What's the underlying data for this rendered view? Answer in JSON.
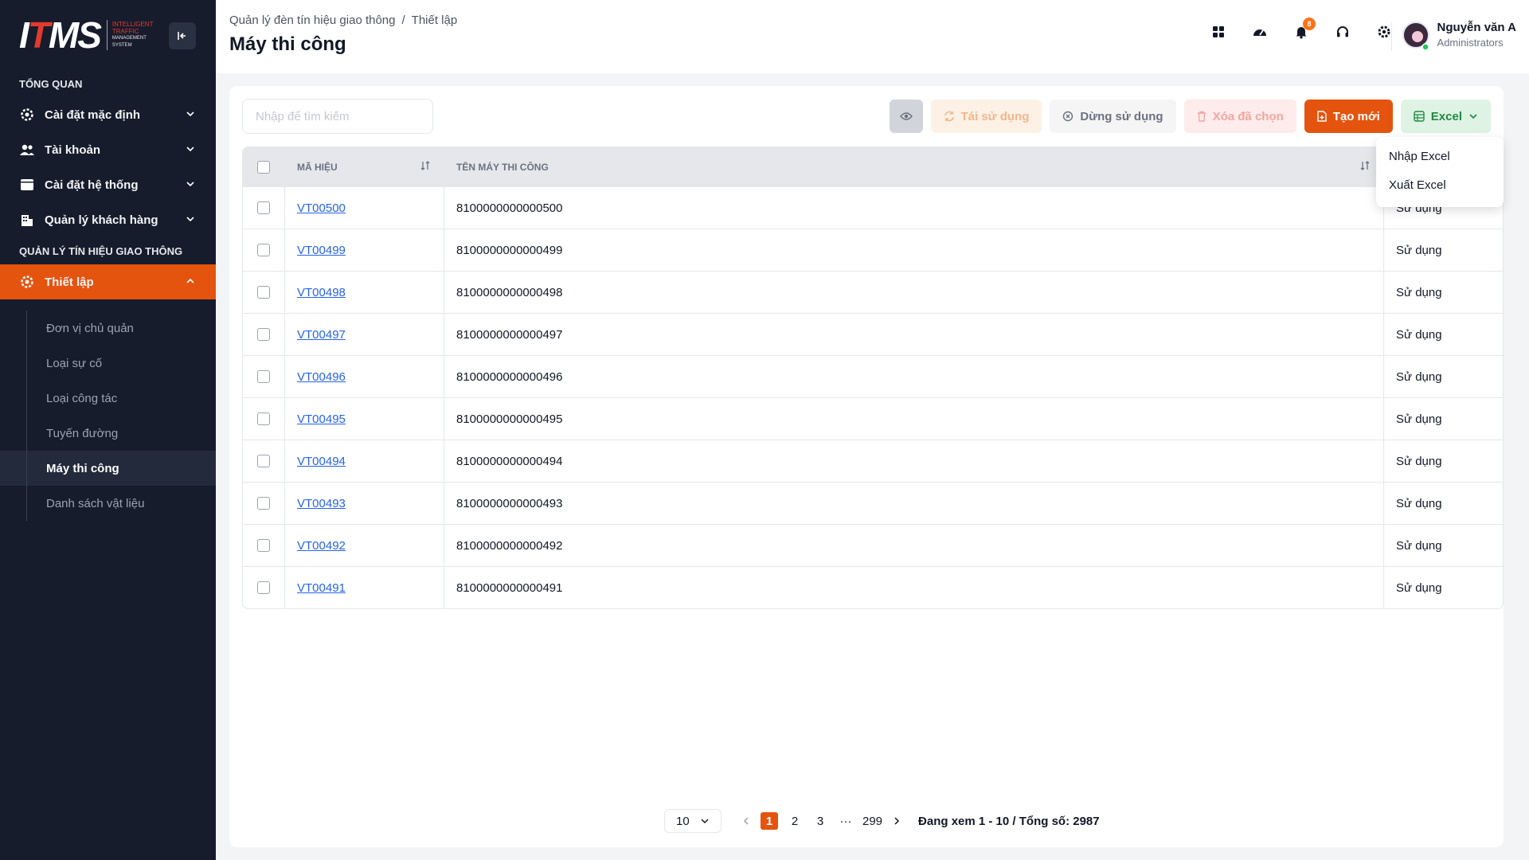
{
  "logo": {
    "main": "ITMS",
    "sub_line1": "INTELLIGENT",
    "sub_line2": "TRAFFIC",
    "sub_line3": "MANAGEMENT",
    "sub_line4": "SYSTEM"
  },
  "sidebar": {
    "section1": "TỔNG QUAN",
    "items": [
      {
        "label": "Cài đặt mặc định",
        "icon": "gear-icon"
      },
      {
        "label": "Tài khoản",
        "icon": "users-icon"
      },
      {
        "label": "Cài đặt hệ thống",
        "icon": "window-icon"
      },
      {
        "label": "Quản lý khách hàng",
        "icon": "building-icon"
      }
    ],
    "section2": "QUẢN LÝ TÍN HIỆU GIAO THÔNG",
    "active_item": {
      "label": "Thiết lập",
      "icon": "gear-icon"
    },
    "subitems": [
      "Đơn vị chủ quản",
      "Loại sự cố",
      "Loại công tác",
      "Tuyến đường",
      "Máy thi công",
      "Danh sách vật liệu"
    ],
    "active_subitem": "Máy thi công"
  },
  "header": {
    "breadcrumb": [
      "Quản lý đèn tín hiệu giao thông",
      "/",
      "Thiết lập"
    ],
    "title": "Máy thi công",
    "notification_count": "8",
    "user_name": "Nguyễn văn A",
    "user_role": "Administrators"
  },
  "toolbar": {
    "search_placeholder": "Nhập để tìm kiếm",
    "reuse_label": "Tái sử dụng",
    "stop_label": "Dừng sử dụng",
    "delete_label": "Xóa đã chọn",
    "create_label": "Tạo mới",
    "excel_label": "Excel"
  },
  "excel_menu": {
    "import": "Nhập Excel",
    "export": "Xuất Excel"
  },
  "table": {
    "columns": {
      "code": "MÃ HIỆU",
      "name": "TÊN MÁY THI CÔNG"
    },
    "rows": [
      {
        "code": "VT00500",
        "name": "8100000000000500",
        "status": "Sử dụng"
      },
      {
        "code": "VT00499",
        "name": "8100000000000499",
        "status": "Sử dụng"
      },
      {
        "code": "VT00498",
        "name": "8100000000000498",
        "status": "Sử dụng"
      },
      {
        "code": "VT00497",
        "name": "8100000000000497",
        "status": "Sử dụng"
      },
      {
        "code": "VT00496",
        "name": "8100000000000496",
        "status": "Sử dụng"
      },
      {
        "code": "VT00495",
        "name": "8100000000000495",
        "status": "Sử dụng"
      },
      {
        "code": "VT00494",
        "name": "8100000000000494",
        "status": "Sử dụng"
      },
      {
        "code": "VT00493",
        "name": "8100000000000493",
        "status": "Sử dụng"
      },
      {
        "code": "VT00492",
        "name": "8100000000000492",
        "status": "Sử dụng"
      },
      {
        "code": "VT00491",
        "name": "8100000000000491",
        "status": "Sử dụng"
      }
    ]
  },
  "pagination": {
    "page_size": "10",
    "pages": [
      "1",
      "2",
      "3",
      "···",
      "299"
    ],
    "current": "1",
    "info": "Đang xem 1 - 10 / Tổng số: 2987"
  },
  "colors": {
    "accent": "#e4540f",
    "sidebar_bg": "#161c2c",
    "link": "#2563eb",
    "excel": "#1f8a43"
  }
}
